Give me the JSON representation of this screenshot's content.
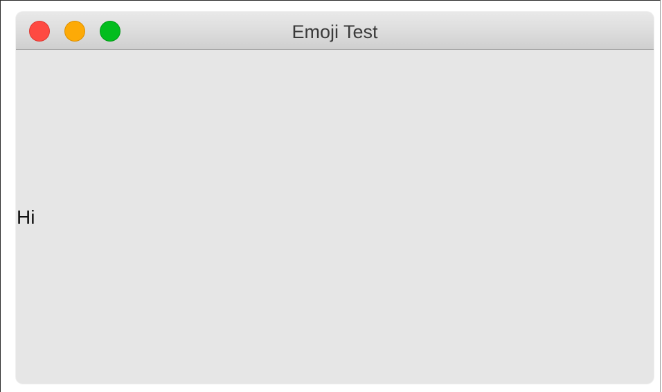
{
  "window": {
    "title": "Emoji Test",
    "buttons": [
      {
        "name": "close",
        "color": "#fe4a42",
        "border": "#dd3a33"
      },
      {
        "name": "minimize",
        "color": "#fdaa07",
        "border": "#dc8f00"
      },
      {
        "name": "zoom",
        "color": "#03bd1e",
        "border": "#029a17"
      }
    ]
  },
  "content": {
    "label": "Hi"
  },
  "colors": {
    "window_background": "#e6e6e6",
    "titlebar_top": "#e9e9e9",
    "titlebar_bottom": "#cfcfcf"
  }
}
